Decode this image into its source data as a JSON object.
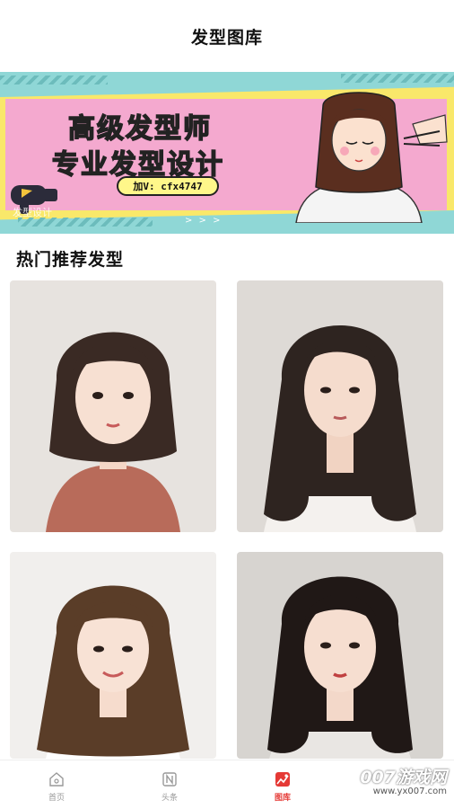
{
  "header": {
    "title": "发型图库"
  },
  "banner": {
    "line1": "高级发型师",
    "line2": "专业发型设计",
    "contact": "加V: cfx4747",
    "faded_text": "发型设计",
    "arrows": "> > >"
  },
  "section": {
    "title": "热门推荐发型"
  },
  "cards": [
    {
      "hair": "#3a2a24",
      "top": "#b86b5a",
      "bg": "#e7e3df"
    },
    {
      "hair": "#2e2420",
      "top": "#f4f1ee",
      "bg": "#dedad6"
    },
    {
      "hair": "#5a3d28",
      "top": "#ffffff",
      "bg": "#f1efed"
    },
    {
      "hair": "#201816",
      "top": "#e9e6e3",
      "bg": "#d7d4d0"
    }
  ],
  "tabbar": {
    "items": [
      {
        "label": "首页",
        "icon": "home-icon",
        "active": false
      },
      {
        "label": "头条",
        "icon": "news-icon",
        "active": false
      },
      {
        "label": "图库",
        "icon": "gallery-icon",
        "active": true
      },
      {
        "label": "",
        "icon": "",
        "active": false
      }
    ]
  },
  "watermark": {
    "main": "007游戏网",
    "url": "www.yx007.com"
  },
  "colors": {
    "accent": "#e53935",
    "banner_yellow": "#f9e86a",
    "banner_pink": "#f4a9cf",
    "banner_teal": "#8fd7d6"
  }
}
